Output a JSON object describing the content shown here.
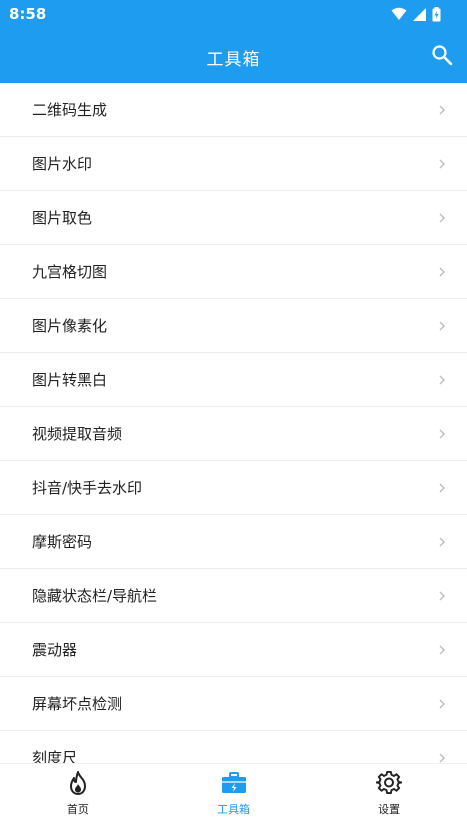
{
  "status": {
    "time": "8:58"
  },
  "appbar": {
    "title": "工具箱"
  },
  "list": {
    "items": [
      {
        "label": "二维码生成"
      },
      {
        "label": "图片水印"
      },
      {
        "label": "图片取色"
      },
      {
        "label": "九宫格切图"
      },
      {
        "label": "图片像素化"
      },
      {
        "label": "图片转黑白"
      },
      {
        "label": "视频提取音频"
      },
      {
        "label": "抖音/快手去水印"
      },
      {
        "label": "摩斯密码"
      },
      {
        "label": "隐藏状态栏/导航栏"
      },
      {
        "label": "震动器"
      },
      {
        "label": "屏幕坏点检测"
      },
      {
        "label": "刻度尺"
      }
    ]
  },
  "tabs": [
    {
      "label": "首页",
      "icon": "fire-icon"
    },
    {
      "label": "工具箱",
      "icon": "toolbox-icon",
      "active": true
    },
    {
      "label": "设置",
      "icon": "gear-icon"
    }
  ],
  "colors": {
    "primary": "#1e9cf0"
  }
}
